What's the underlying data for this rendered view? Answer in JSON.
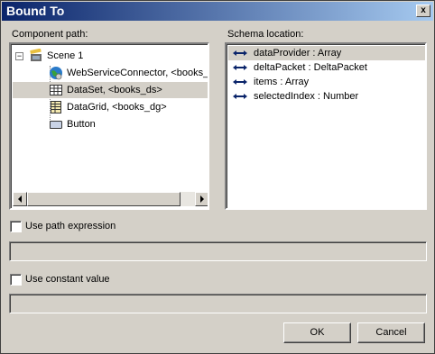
{
  "window": {
    "title": "Bound To",
    "close_glyph": "x"
  },
  "component_path": {
    "label": "Component path:",
    "items": [
      {
        "label": "Scene 1",
        "icon": "scene-icon"
      },
      {
        "label": "WebServiceConnector, <books_ws>",
        "icon": "web-service-icon"
      },
      {
        "label": "DataSet, <books_ds>",
        "icon": "dataset-icon",
        "selected": true
      },
      {
        "label": "DataGrid, <books_dg>",
        "icon": "datagrid-icon"
      },
      {
        "label": "Button",
        "icon": "button-icon"
      }
    ],
    "expander_glyph": "−"
  },
  "schema_location": {
    "label": "Schema location:",
    "items": [
      {
        "label": "dataProvider : Array",
        "selected": true
      },
      {
        "label": "deltaPacket : DeltaPacket"
      },
      {
        "label": "items : Array"
      },
      {
        "label": "selectedIndex : Number"
      }
    ]
  },
  "use_path_expression": {
    "label": "Use path expression",
    "checked": false,
    "value": ""
  },
  "use_constant_value": {
    "label": "Use constant value",
    "checked": false,
    "value": ""
  },
  "buttons": {
    "ok": "OK",
    "cancel": "Cancel"
  },
  "colors": {
    "title_start": "#0a246a",
    "title_end": "#a6caf0",
    "face": "#d4d0c8"
  }
}
